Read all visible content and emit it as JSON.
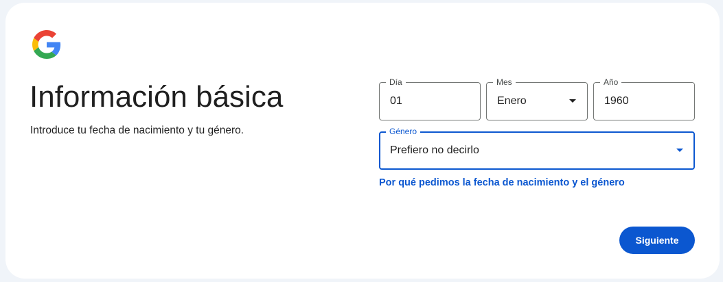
{
  "header": {
    "logo_icon": "google-g-logo-icon",
    "title": "Información básica",
    "subtitle": "Introduce tu fecha de nacimiento y tu género."
  },
  "birthdate": {
    "day": {
      "label": "Día",
      "value": "01"
    },
    "month": {
      "label": "Mes",
      "value": "Enero"
    },
    "year": {
      "label": "Año",
      "value": "1960"
    }
  },
  "gender": {
    "label": "Género",
    "value": "Prefiero no decirlo"
  },
  "why_link": "Por qué pedimos la fecha de nacimiento y el género",
  "next_button": "Siguiente",
  "colors": {
    "background": "#f0f4f9",
    "card": "#ffffff",
    "accent": "#0b57d0",
    "text": "#1f1f1f",
    "border": "#747775"
  }
}
